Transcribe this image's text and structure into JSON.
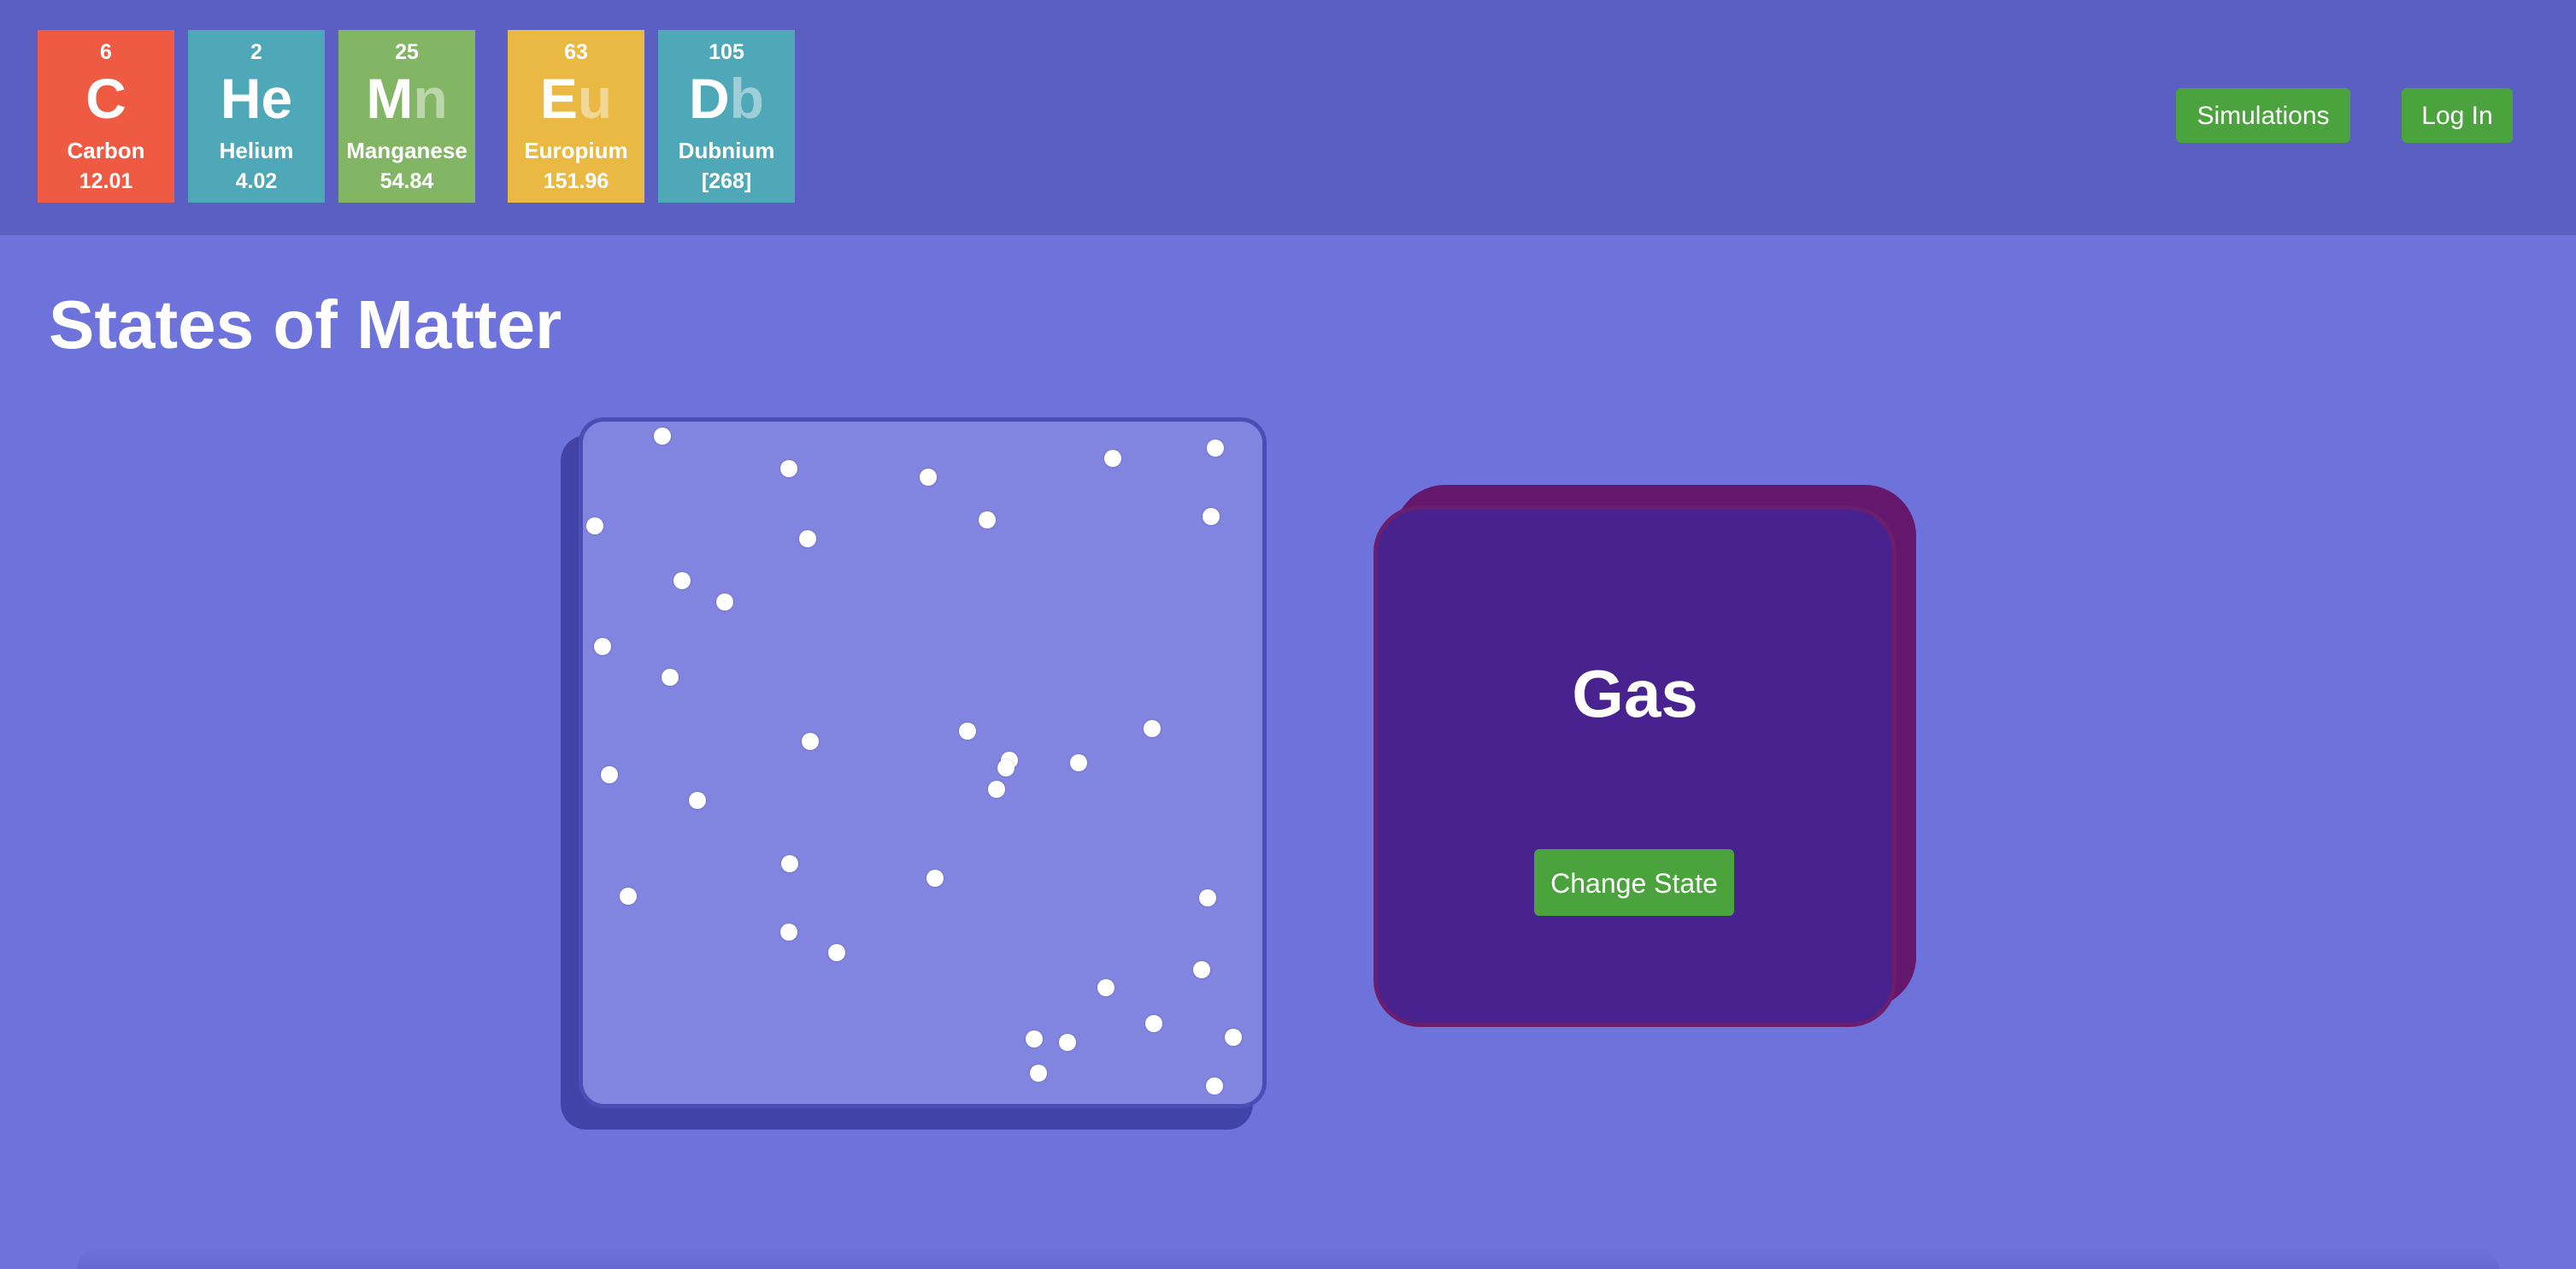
{
  "header": {
    "elements": [
      {
        "number": "6",
        "symbol_main": "C",
        "symbol_faded": "",
        "name": "Carbon",
        "mass": "12.01",
        "color": "#ef5a43"
      },
      {
        "number": "2",
        "symbol_main": "He",
        "symbol_faded": "",
        "name": "Helium",
        "mass": "4.02",
        "color": "#4ea8b8"
      },
      {
        "number": "25",
        "symbol_main": "M",
        "symbol_faded": "n",
        "name": "Manganese",
        "mass": "54.84",
        "color": "#82b564"
      },
      {
        "number": "63",
        "symbol_main": "E",
        "symbol_faded": "u",
        "name": "Europium",
        "mass": "151.96",
        "color": "#e9b944"
      },
      {
        "number": "105",
        "symbol_main": "D",
        "symbol_faded": "b",
        "name": "Dubnium",
        "mass": "[268]",
        "color": "#4ea8b8"
      }
    ],
    "nav": {
      "simulations_label": "Simulations",
      "login_label": "Log In"
    }
  },
  "main": {
    "title": "States of Matter",
    "state": {
      "label": "Gas",
      "change_button_label": "Change State"
    }
  },
  "colors": {
    "button_green": "#4aa33c",
    "header_bg": "#5c5fc2",
    "page_bg": "#6e73dc",
    "container_bg": "#8285e0",
    "state_card_bg": "#48228e",
    "state_card_shadow": "#65176b"
  }
}
